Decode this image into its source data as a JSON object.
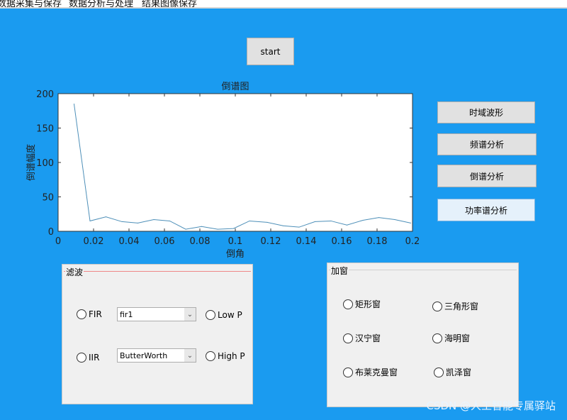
{
  "menu": [
    "数据采集与保存",
    "数据分析与处理",
    "结果图像保存"
  ],
  "start_label": "start",
  "side_buttons": [
    "时域波形",
    "频谱分析",
    "倒谱分析",
    "功率谱分析"
  ],
  "chart_data": {
    "type": "line",
    "title": "倒谱图",
    "xlabel": "倒角",
    "ylabel": "倒谱幅度",
    "xlim": [
      0,
      0.2
    ],
    "ylim": [
      0,
      200
    ],
    "xticks": [
      "0",
      "0.02",
      "0.04",
      "0.06",
      "0.08",
      "0.1",
      "0.12",
      "0.14",
      "0.16",
      "0.18",
      "0.2"
    ],
    "yticks": [
      "0",
      "50",
      "100",
      "150",
      "200"
    ],
    "x": [
      0.009,
      0.018,
      0.027,
      0.036,
      0.045,
      0.054,
      0.063,
      0.072,
      0.081,
      0.09,
      0.099,
      0.108,
      0.118,
      0.127,
      0.136,
      0.145,
      0.154,
      0.163,
      0.172,
      0.181,
      0.19,
      0.199
    ],
    "y": [
      185,
      15,
      21,
      14,
      12,
      17,
      15,
      3,
      7,
      3,
      4,
      15,
      13,
      8,
      6,
      14,
      15,
      9,
      16,
      20,
      17,
      12
    ],
    "color": "#4d8fb8"
  },
  "filter": {
    "title": "滤波",
    "fir": "FIR",
    "iir": "IIR",
    "fir_select": "fir1",
    "iir_select": "ButterWorth",
    "lowp": "Low P",
    "highp": "High P"
  },
  "window": {
    "title": "加窗",
    "items": [
      "矩形窗",
      "三角形窗",
      "汉宁窗",
      "海明窗",
      "布莱克曼窗",
      "凯泽窗"
    ]
  },
  "watermark": "CSDN @人工智能专属驿站"
}
